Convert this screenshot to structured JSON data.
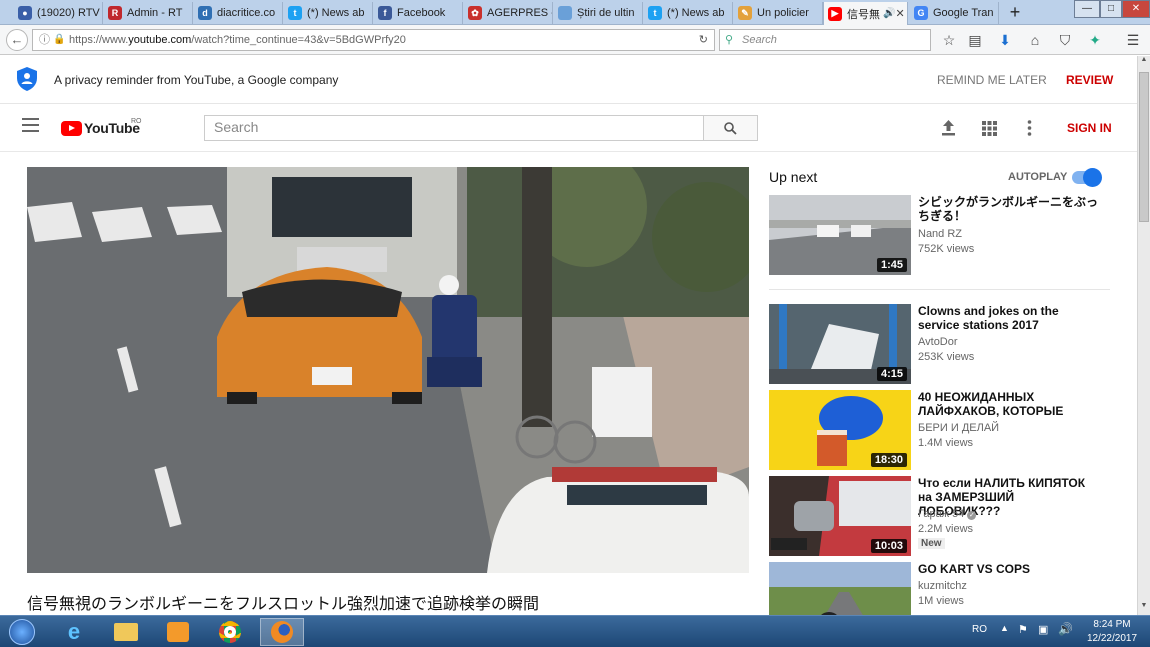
{
  "browser": {
    "tabs": [
      {
        "label": "(19020) RTV",
        "icon": "rtv-icon",
        "color": "#3a5fa8"
      },
      {
        "label": "Admin - RT",
        "icon": "rtv-admin-icon",
        "color": "#c0282d"
      },
      {
        "label": "diacritice.co",
        "icon": "d-icon",
        "color": "#2f6fb3"
      },
      {
        "label": "(*) News ab",
        "icon": "twitter-icon",
        "color": "#1da1f2"
      },
      {
        "label": "Facebook",
        "icon": "facebook-icon",
        "color": "#3b5998"
      },
      {
        "label": "AGERPRES -",
        "icon": "agerpres-icon",
        "color": "#c9302c"
      },
      {
        "label": "Știri de ultin",
        "icon": "stiri-icon",
        "color": "#6aa0d8"
      },
      {
        "label": "(*) News ab",
        "icon": "twitter-icon",
        "color": "#1da1f2"
      },
      {
        "label": "Un policier",
        "icon": "policier-icon",
        "color": "#e3a13b"
      },
      {
        "label": "信号無",
        "icon": "youtube-icon",
        "color": "#ff0000",
        "active": true
      },
      {
        "label": "Google Tran",
        "icon": "google-translate-icon",
        "color": "#4285f4"
      }
    ],
    "window_controls": {
      "minimize": "—",
      "maximize": "□",
      "close": "✕"
    },
    "url_prefix": "https://www.",
    "url_domain": "youtube.com",
    "url_path": "/watch?time_continue=43&v=5BdGWPrfy20",
    "search_placeholder": "Search"
  },
  "privacy": {
    "text": "A privacy reminder from YouTube, a Google company",
    "remind_label": "REMIND ME LATER",
    "review_label": "REVIEW"
  },
  "yt_header": {
    "logo_text": "YouTube",
    "country_code": "RO",
    "search_placeholder": "Search",
    "signin_label": "SIGN IN"
  },
  "video": {
    "title": "信号無視のランボルギーニをフルスロットル強烈加速で追跡検挙の瞬間"
  },
  "up_next": {
    "heading": "Up next",
    "autoplay_label": "AUTOPLAY",
    "autoplay_on": true,
    "items": [
      {
        "title": "シビックがランボルギーニをぶっちぎる！",
        "channel": "Nand RZ",
        "views": "752K views",
        "duration": "1:45",
        "badge": ""
      },
      {
        "title": "Clowns and jokes on the service stations 2017",
        "channel": "AvtoDor",
        "views": "253K views",
        "duration": "4:15",
        "badge": ""
      },
      {
        "title": "40 НЕОЖИДАННЫХ ЛАЙФХАКОВ, КОТОРЫЕ",
        "channel": "БЕРИ И ДЕЛАЙ",
        "views": "1.4M views",
        "duration": "18:30",
        "badge": ""
      },
      {
        "title": "Что если НАЛИТЬ КИПЯТОК на ЗАМЕРЗШИЙ ЛОБОВИК???",
        "channel": "Гараж 54",
        "views": "2.2M views",
        "duration": "10:03",
        "badge": "New"
      },
      {
        "title": "GO KART VS COPS",
        "channel": "kuzmitchz",
        "views": "1M views",
        "duration": "",
        "badge": ""
      }
    ]
  },
  "taskbar": {
    "language": "RO",
    "time": "8:24 PM",
    "date": "12/22/2017"
  }
}
